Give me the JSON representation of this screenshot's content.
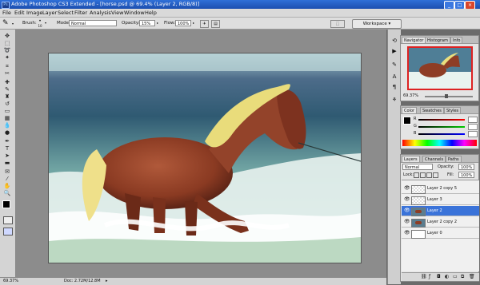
{
  "titlebar": {
    "title": "Adobe Photoshop CS3 Extended - [horse.psd @ 69.4% (Layer 2, RGB/8)]",
    "app_icon": "Ps"
  },
  "menu": [
    "File",
    "Edit",
    "Image",
    "Layer",
    "Select",
    "Filter",
    "Analysis",
    "View",
    "Window",
    "Help"
  ],
  "options": {
    "brush_label": "Brush:",
    "brush_size": "10",
    "mode_label": "Mode:",
    "mode_value": "Normal",
    "opacity_label": "Opacity:",
    "opacity_value": "15%",
    "flow_label": "Flow:",
    "flow_value": "100%",
    "workspace_label": "Workspace"
  },
  "status": {
    "zoom": "69.37%",
    "doc": "Doc: 2.72M/12.8M"
  },
  "navigator": {
    "tabs": [
      "Navigator",
      "Histogram",
      "Info"
    ],
    "zoom": "69.37%"
  },
  "color": {
    "tabs": [
      "Color",
      "Swatches",
      "Styles"
    ],
    "channels": [
      "R",
      "G",
      "B"
    ],
    "values": [
      "",
      "",
      ""
    ]
  },
  "layers": {
    "tabs": [
      "Layers",
      "Channels",
      "Paths"
    ],
    "blend": "Normal",
    "opacity_label": "Opacity:",
    "opacity_value": "100%",
    "lock_label": "Lock:",
    "fill_label": "Fill:",
    "fill_value": "100%",
    "items": [
      {
        "name": "Layer 2 copy 5",
        "selected": false
      },
      {
        "name": "Layer 3",
        "selected": false
      },
      {
        "name": "Layer 2",
        "selected": true
      },
      {
        "name": "Layer 2 copy 2",
        "selected": false
      },
      {
        "name": "Layer 0",
        "selected": false
      }
    ]
  },
  "icons": [
    "brush-icon",
    "move-icon",
    "marquee-icon",
    "lasso-icon",
    "crop-icon",
    "eye-icon",
    "chain-icon",
    "trash-icon",
    "new-layer-icon"
  ]
}
